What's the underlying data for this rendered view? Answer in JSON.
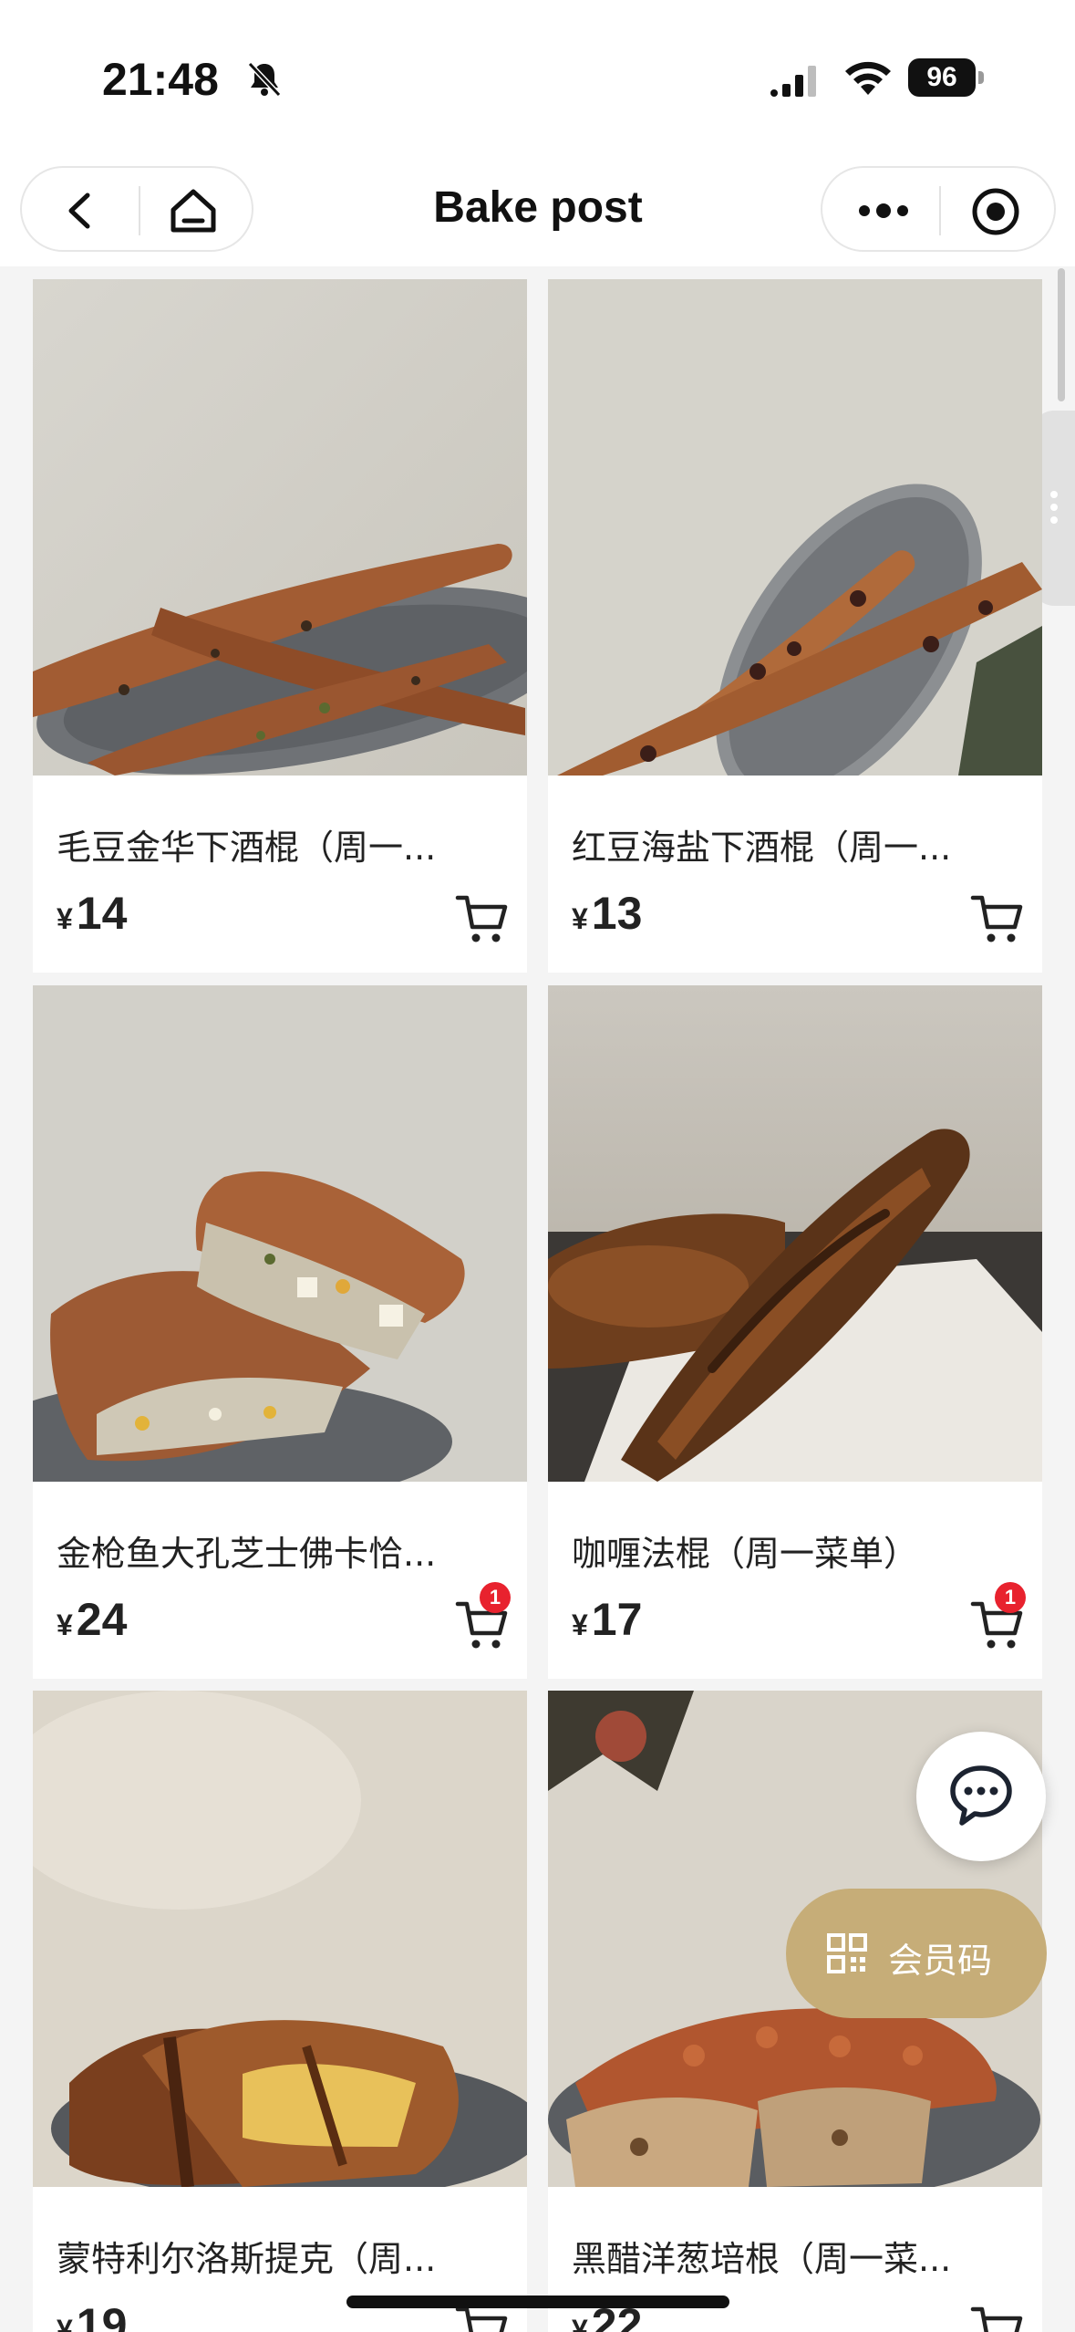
{
  "status_bar": {
    "time": "21:48",
    "battery": "96"
  },
  "nav": {
    "title": "Bake post"
  },
  "products": [
    {
      "name": "毛豆金华下酒棍（周一...",
      "currency": "¥",
      "price": "14",
      "cart_badge": ""
    },
    {
      "name": "红豆海盐下酒棍（周一...",
      "currency": "¥",
      "price": "13",
      "cart_badge": ""
    },
    {
      "name": "金枪鱼大孔芝士佛卡恰...",
      "currency": "¥",
      "price": "24",
      "cart_badge": "1"
    },
    {
      "name": "咖喱法棍（周一菜单）",
      "currency": "¥",
      "price": "17",
      "cart_badge": "1"
    },
    {
      "name": "蒙特利尔洛斯提克（周...",
      "currency": "¥",
      "price": "19",
      "cart_badge": ""
    },
    {
      "name": "黑醋洋葱培根（周一菜...",
      "currency": "¥",
      "price": "22",
      "cart_badge": ""
    }
  ],
  "floating": {
    "member_code_label": "会员码"
  },
  "colors": {
    "badge": "#e8222e",
    "member_button": "#c6ad78",
    "background": "#f4f4f4"
  }
}
